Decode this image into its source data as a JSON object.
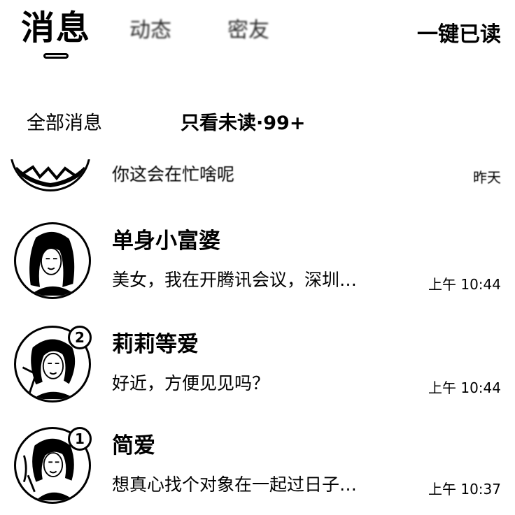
{
  "header": {
    "tab_active": "消息",
    "tab_2": "动态",
    "tab_3": "密友",
    "mark_all_read": "一键已读"
  },
  "filters": {
    "all": "全部消息",
    "unread_only": "只看未读·99+"
  },
  "conversations": [
    {
      "name": "",
      "preview": "你这会在忙啥呢",
      "time": "昨天",
      "unread": null
    },
    {
      "name": "单身小富婆",
      "preview": "美女，我在开腾讯会议，深圳…",
      "time": "上午 10:44",
      "unread": null
    },
    {
      "name": "莉莉等爱",
      "preview": "好近，方便见见吗？",
      "time": "上午 10:44",
      "unread": "2"
    },
    {
      "name": "简爱",
      "preview": "想真心找个对象在一起过日子…",
      "time": "上午 10:37",
      "unread": "1"
    }
  ]
}
